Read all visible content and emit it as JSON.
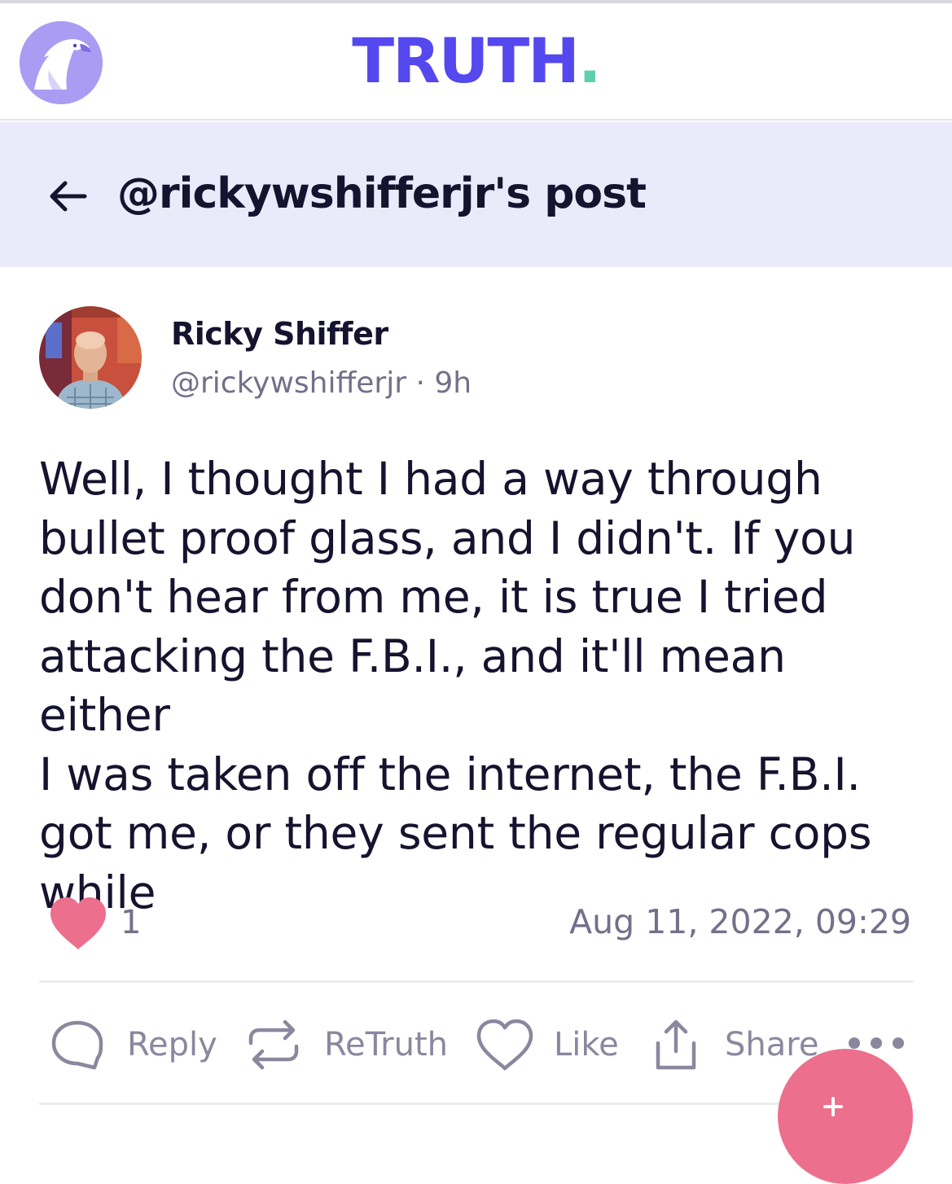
{
  "app": {
    "brand_name": "TRUTH",
    "brand_dot": ".",
    "brand_color": "#5448ee",
    "brand_dot_color": "#5fcfae",
    "logo_icon": "eagle-logo"
  },
  "header": {
    "back_icon": "arrow-left-icon",
    "title": "@rickywshifferjr's post"
  },
  "post": {
    "display_name": "Ricky Shiffer",
    "handle": "@rickywshifferjr",
    "separator": "·",
    "age": "9h",
    "body": "Well, I thought I had a way through\nbullet proof glass, and I didn't.  If you\ndon't hear from me, it is true I tried\nattacking the F.B.I., and it'll mean either\nI was taken off the internet, the F.B.I.\ngot me, or they sent the regular cops\nwhile",
    "like_count": "1",
    "timestamp": "Aug 11, 2022, 09:29",
    "like_color": "#ec6f8d"
  },
  "actions": {
    "reply": "Reply",
    "retruth": "ReTruth",
    "like": "Like",
    "share": "Share",
    "more_icon": "more-dots-icon"
  },
  "fab": {
    "icon": "plus-icon",
    "color": "#ec6f8d"
  }
}
